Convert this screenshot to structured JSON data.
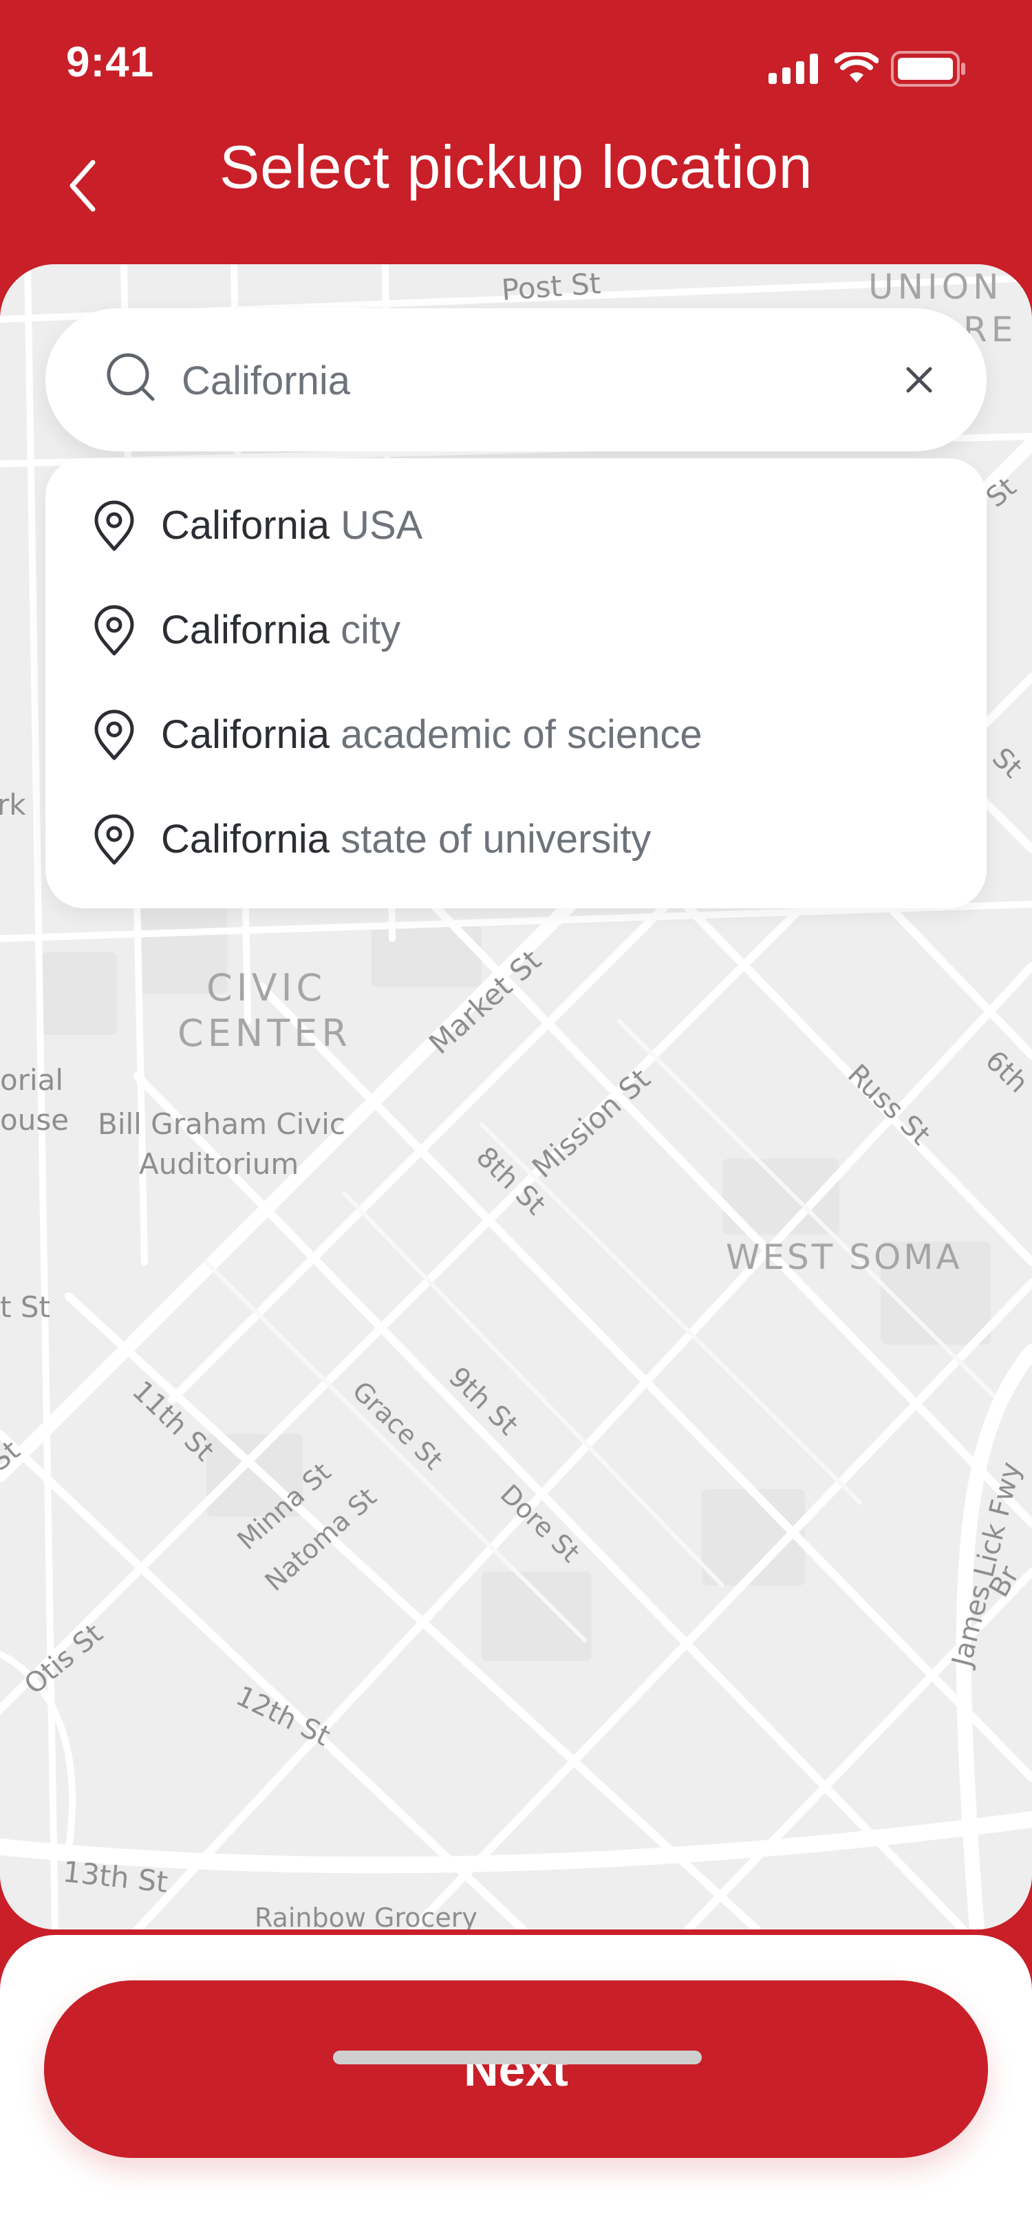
{
  "status_bar": {
    "time": "9:41"
  },
  "header": {
    "title": "Select pickup location"
  },
  "search": {
    "value": "California",
    "icon": "search-icon",
    "clear_icon": "close-icon"
  },
  "suggestions": [
    {
      "main": "California",
      "rest": " USA"
    },
    {
      "main": "California",
      "rest": " city"
    },
    {
      "main": "California",
      "rest": " academic of science"
    },
    {
      "main": "California",
      "rest": " state of university"
    }
  ],
  "map": {
    "labels": {
      "post_st": "Post St",
      "union": "UNION",
      "re": "RE",
      "civic": "CIVIC",
      "center": "CENTER",
      "market_st": "Market St",
      "mission_st": "Mission St",
      "russ_st": "Russ St",
      "sixth": "6th",
      "eighth_st": "8th St",
      "west_soma": "WEST SOMA",
      "morial": "orial",
      "ouse": "ouse",
      "bill_graham": "Bill Graham Civic",
      "auditorium": "Auditorium",
      "st_left": "St",
      "eleventh_st": "11th St",
      "ninth_st": "9th St",
      "grace_st": "Grace St",
      "minna_st": "Minna St",
      "natoma_st": "Natoma St",
      "dore_st": "Dore St",
      "james_lick": "James Lick Fwy",
      "br": "Br",
      "otis_st": "Otis St",
      "twelfth_st": "12th St",
      "thirteenth_st": "13th St",
      "rainbow": "Rainbow Grocery",
      "rk": "rk",
      "st_right": "St",
      "st_right2": "St",
      "t_st": "t St"
    }
  },
  "footer": {
    "next_label": "Next"
  },
  "colors": {
    "brand": "#c81f28",
    "map_bg": "#efefef",
    "road": "#ffffff"
  }
}
